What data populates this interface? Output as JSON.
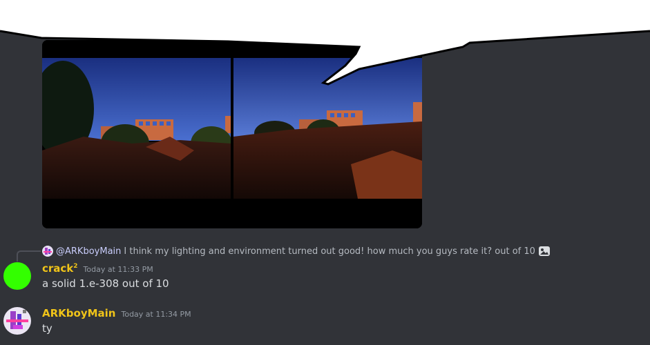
{
  "attachments": {
    "image_count": 2
  },
  "reply": {
    "mention": "@ARKboyMain",
    "text": "I think my lighting and environment turned out good! how much you guys rate it? out of 10",
    "attachment_icon": "image-icon"
  },
  "messages": [
    {
      "username": "crack",
      "username_superscript": "2",
      "timestamp": "Today at 11:33 PM",
      "text": "a solid 1.e-308 out of 10",
      "avatar_color": "#33ff00"
    },
    {
      "username": "ARKboyMain",
      "timestamp": "Today at 11:34 PM",
      "text": "ty"
    }
  ],
  "colors": {
    "background": "#313338",
    "username": "#f0c419",
    "mention": "#c9cdfb"
  }
}
